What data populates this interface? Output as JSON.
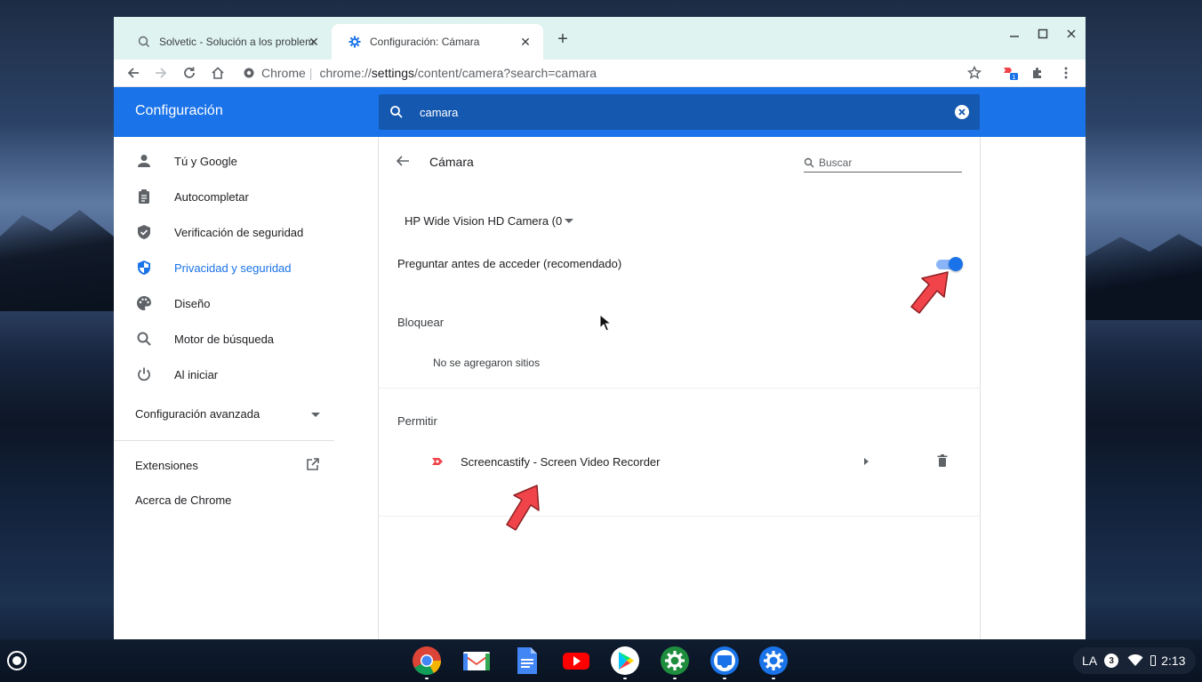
{
  "browser": {
    "tabs": [
      {
        "title": "Solvetic - Solución a los problemas",
        "active": false
      },
      {
        "title": "Configuración: Cámara",
        "active": true
      }
    ],
    "new_tab_label": "+",
    "close_label": "✕",
    "omnibox": {
      "chip": "Chrome",
      "url_prefix": "chrome://",
      "url_host": "settings",
      "url_path": "/content/camera?search=camara"
    },
    "extension_badge": "1"
  },
  "settings": {
    "header_title": "Configuración",
    "search_value": "camara",
    "sidebar": {
      "items": [
        {
          "label": "Tú y Google",
          "icon": "person-icon"
        },
        {
          "label": "Autocompletar",
          "icon": "clipboard-icon"
        },
        {
          "label": "Verificación de seguridad",
          "icon": "shield-check-icon"
        },
        {
          "label": "Privacidad y seguridad",
          "icon": "shield-icon",
          "active": true
        },
        {
          "label": "Diseño",
          "icon": "palette-icon"
        },
        {
          "label": "Motor de búsqueda",
          "icon": "search-icon"
        },
        {
          "label": "Al iniciar",
          "icon": "power-icon"
        }
      ],
      "advanced_label": "Configuración avanzada",
      "extensions_label": "Extensiones",
      "about_label": "Acerca de Chrome"
    },
    "camera": {
      "page_title": "Cámara",
      "search_placeholder": "Buscar",
      "device_label": "HP Wide Vision HD Camera (0",
      "ask_label": "Preguntar antes de acceder (recomendado)",
      "ask_enabled": true,
      "block_header": "Bloquear",
      "block_empty": "No se agregaron sitios",
      "allow_header": "Permitir",
      "allowed_sites": [
        {
          "name": "Screencastify - Screen Video Recorder"
        }
      ]
    }
  },
  "shelf": {
    "apps": [
      "chrome-icon",
      "gmail-icon",
      "docs-icon",
      "youtube-icon",
      "play-store-icon",
      "settings-icon",
      "screencast-icon",
      "settings-icon"
    ],
    "tray": {
      "language": "LA",
      "notifications": "3",
      "time": "2:13"
    }
  },
  "colors": {
    "accent": "#1a73e8",
    "header_search": "#1558b0",
    "tabstrip": "#dff3f1",
    "annotation_arrow": "#f0444a"
  }
}
